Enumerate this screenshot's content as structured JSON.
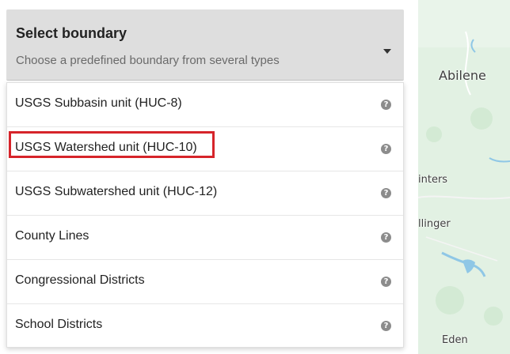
{
  "select": {
    "title": "Select boundary",
    "subtitle": "Choose a predefined boundary from several types",
    "caret_icon": "caret-down-icon"
  },
  "options": [
    {
      "label": "USGS Subbasin unit (HUC-8)",
      "help_icon": "?"
    },
    {
      "label": "USGS Watershed unit (HUC-10)",
      "help_icon": "?",
      "highlighted": true
    },
    {
      "label": "USGS Subwatershed unit (HUC-12)",
      "help_icon": "?"
    },
    {
      "label": "County Lines",
      "help_icon": "?"
    },
    {
      "label": "Congressional Districts",
      "help_icon": "?"
    },
    {
      "label": "School Districts",
      "help_icon": "?"
    }
  ],
  "map": {
    "labels": [
      "Abilene",
      "inters",
      "llinger",
      "Eden"
    ],
    "colors": {
      "land": "#dff0e1",
      "water": "#8fc7e6",
      "highlight": "#d6242a"
    }
  }
}
